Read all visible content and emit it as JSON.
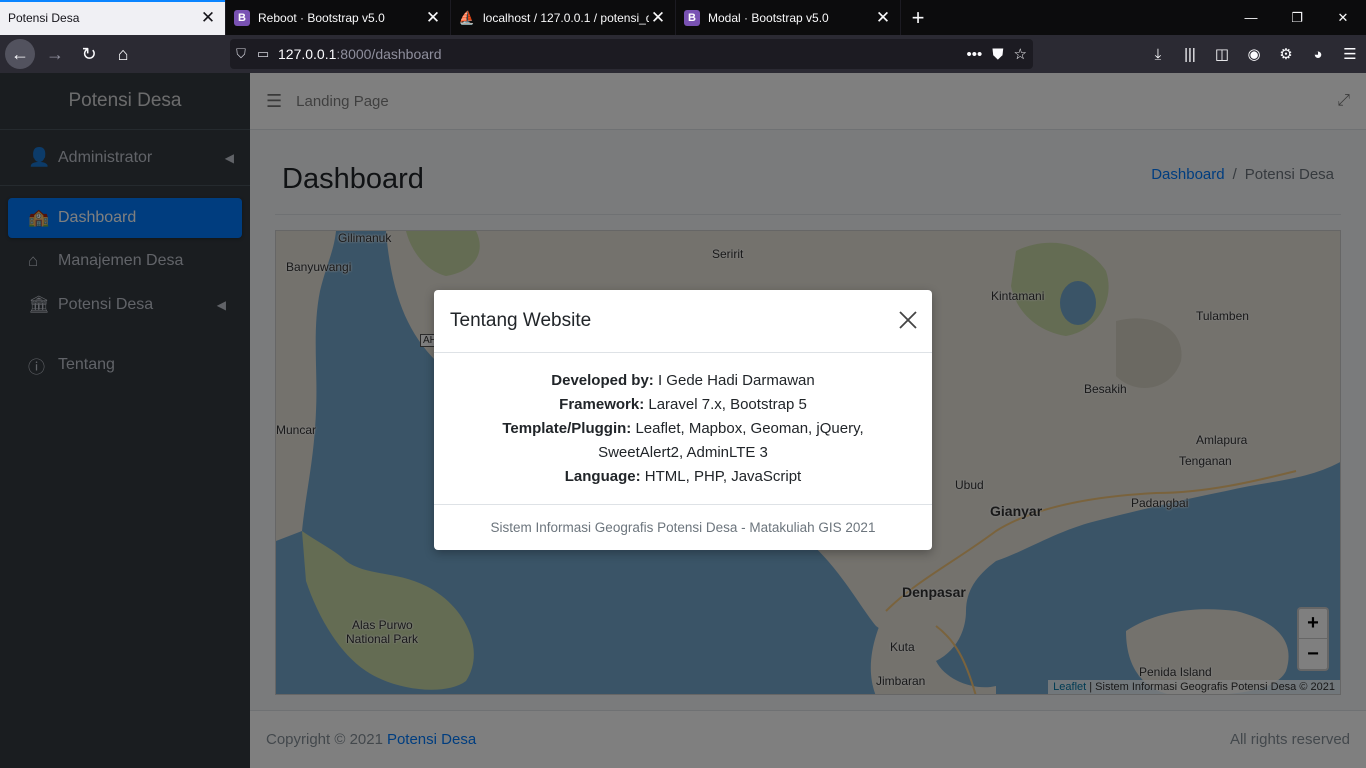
{
  "browser": {
    "tabs": [
      {
        "title": "Potensi Desa",
        "favicon": "none"
      },
      {
        "title": "Reboot · Bootstrap v5.0",
        "favicon": "B"
      },
      {
        "title": "localhost / 127.0.0.1 / potensi_d",
        "favicon": "phpmyadmin-icon"
      },
      {
        "title": "Modal · Bootstrap v5.0",
        "favicon": "B"
      }
    ],
    "url_host": "127.0.0.1",
    "url_path": ":8000/dashboard"
  },
  "sidebar": {
    "brand": "Potensi Desa",
    "user": "Administrator",
    "items": [
      {
        "label": "Dashboard",
        "icon": "school-icon"
      },
      {
        "label": "Manajemen Desa",
        "icon": "home-icon"
      },
      {
        "label": "Potensi Desa",
        "icon": "landmark-icon"
      },
      {
        "label": "Tentang",
        "icon": "info-icon"
      }
    ]
  },
  "topbar": {
    "link": "Landing Page"
  },
  "header": {
    "title": "Dashboard",
    "breadcrumb": {
      "link": "Dashboard",
      "separator": "/",
      "current": "Potensi Desa"
    }
  },
  "map": {
    "labels": [
      "Gilimanuk",
      "Banyuwangi",
      "Seririt",
      "Kintamani",
      "Tulamben",
      "Besakih",
      "Muncar",
      "Amlapura",
      "Tenganan",
      "Ubud",
      "Gianyar",
      "Padangbai",
      "Denpasar",
      "Kuta",
      "Jimbaran",
      "Alas Purwo",
      "National Park",
      "Penida Island"
    ],
    "road_badge": "AH",
    "zoom_in": "+",
    "zoom_out": "−",
    "attribution_link": "Leaflet",
    "attribution_text": "| Sistem Informasi Geografis Potensi Desa © 2021",
    "colors": {
      "sea": "#75a9cf",
      "land": "#e8e4da",
      "park": "#c9d8a6"
    }
  },
  "footer": {
    "copyright": "Copyright © 2021",
    "brand": "Potensi Desa",
    "rights": "All rights reserved"
  },
  "modal": {
    "title": "Tentang Website",
    "rows": [
      {
        "label": "Developed by:",
        "value": "I Gede Hadi Darmawan"
      },
      {
        "label": "Framework:",
        "value": "Laravel 7.x, Bootstrap 5"
      },
      {
        "label": "Template/Pluggin:",
        "value": "Leaflet, Mapbox, Geoman, jQuery,"
      },
      {
        "label": "",
        "value": "SweetAlert2, AdminLTE 3"
      },
      {
        "label": "Language:",
        "value": "HTML, PHP, JavaScript"
      }
    ],
    "footer": "Sistem Informasi Geografis Potensi Desa - Matakuliah GIS 2021"
  }
}
